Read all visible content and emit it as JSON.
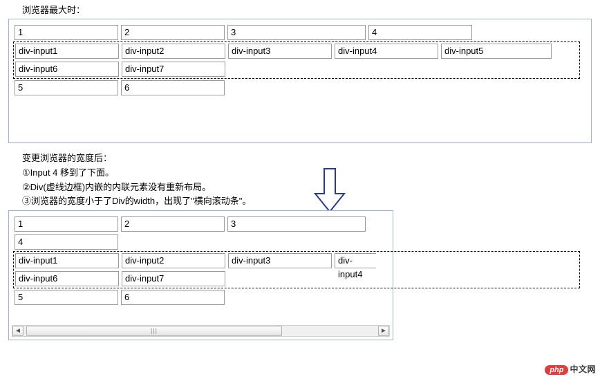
{
  "labels": {
    "top": "浏览器最大时：",
    "after": "变更浏览器的宽度后：",
    "line1": "①Input 4 移到了下面。",
    "line2": "②Div(虚线边框)内嵌的内联元素没有重新布局。",
    "line3": "③浏览器的宽度小于了Div的width，出现了\"横向滚动条\"。"
  },
  "inputs": {
    "n1": "1",
    "n2": "2",
    "n3": "3",
    "n4": "4",
    "n5": "5",
    "n6": "6",
    "d1": "div-input1",
    "d2": "div-input2",
    "d3": "div-input3",
    "d4": "div-input4",
    "d5": "div-input5",
    "d6": "div-input6",
    "d7": "div-input7"
  },
  "scrollbar": {
    "thumb": "|||"
  },
  "watermark": {
    "php": "php",
    "text": "中文网"
  }
}
